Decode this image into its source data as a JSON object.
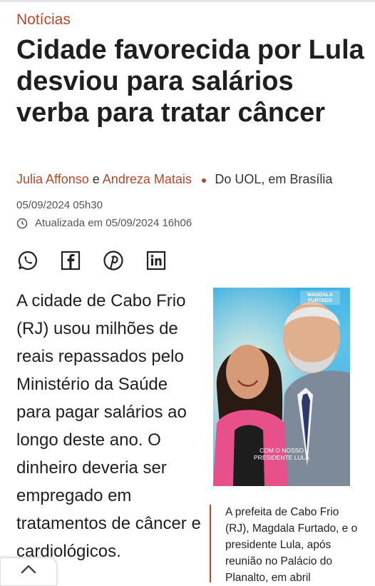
{
  "section": "Notícias",
  "headline": "Cidade favorecida por Lula desviou para salários verba para tratar câncer",
  "byline": {
    "author1": "Julia Affonso",
    "connector": "e",
    "author2": "Andreza Matais",
    "source": "Do UOL, em Brasília"
  },
  "published": "05/09/2024 05h30",
  "updated": "Atualizada em 05/09/2024 16h06",
  "share_icons": [
    "whatsapp-icon",
    "facebook-icon",
    "pinterest-icon",
    "linkedin-icon"
  ],
  "article": {
    "paragraph": "A cidade de Cabo Frio (RJ) usou milhões de reais repassados pelo Ministério da Saúde para pagar salários ao longo deste ano. O dinheiro deveria ser empregado em tratamentos de câncer e cardiológicos."
  },
  "photo": {
    "logo_text": "MAGDALA FURTADO",
    "overlay_line1": "COM O NOSSO",
    "overlay_line2": "PRESIDENTE LULA",
    "caption": "A prefeita de Cabo Frio (RJ), Magdala Furtado, e o presidente Lula, após reunião no Palácio do Planalto, em abril"
  },
  "colors": {
    "accent": "#b5472a",
    "text": "#1f1f1f"
  }
}
